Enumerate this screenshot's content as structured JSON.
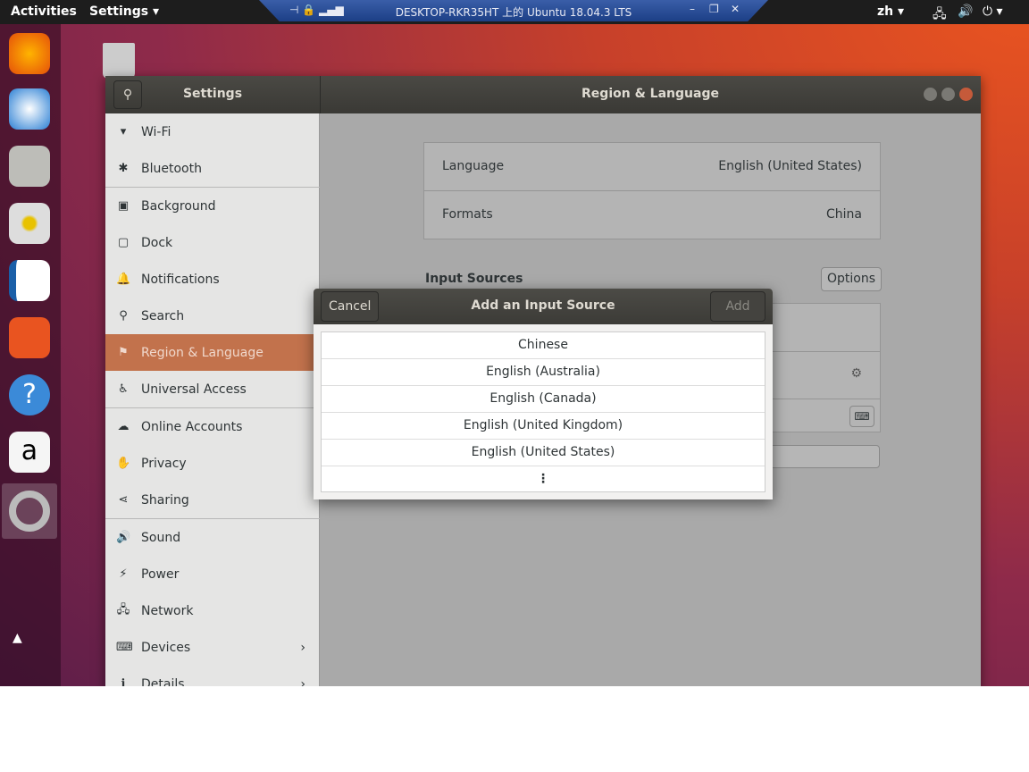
{
  "topbar": {
    "activities": "Activities",
    "app_menu": "Settings ▾",
    "lang": "zh ▾",
    "rdp_title": "DESKTOP-RKR35HT 上的 Ubuntu 18.04.3 LTS"
  },
  "window": {
    "sidebar_title": "Settings",
    "title": "Region & Language"
  },
  "sidebar": {
    "items": [
      {
        "label": "Wi-Fi",
        "icon": "▾"
      },
      {
        "label": "Bluetooth",
        "icon": "✱"
      },
      {
        "label": "Background",
        "icon": "▣"
      },
      {
        "label": "Dock",
        "icon": "▢"
      },
      {
        "label": "Notifications",
        "icon": "🔔"
      },
      {
        "label": "Search",
        "icon": "⚲"
      },
      {
        "label": "Region & Language",
        "icon": "⚑"
      },
      {
        "label": "Universal Access",
        "icon": "♿"
      },
      {
        "label": "Online Accounts",
        "icon": "☁"
      },
      {
        "label": "Privacy",
        "icon": "✋"
      },
      {
        "label": "Sharing",
        "icon": "⋖"
      },
      {
        "label": "Sound",
        "icon": "🔊"
      },
      {
        "label": "Power",
        "icon": "⚡"
      },
      {
        "label": "Network",
        "icon": "🖧"
      },
      {
        "label": "Devices",
        "icon": "⌨"
      },
      {
        "label": "Details",
        "icon": "ℹ"
      }
    ]
  },
  "region": {
    "language_label": "Language",
    "language_value": "English (United States)",
    "formats_label": "Formats",
    "formats_value": "China",
    "input_sources": "Input Sources",
    "options": "Options"
  },
  "dialog": {
    "cancel": "Cancel",
    "title": "Add an Input Source",
    "add": "Add",
    "items": [
      "Chinese",
      "English (Australia)",
      "English (Canada)",
      "English (United Kingdom)",
      "English (United States)"
    ],
    "more": "⋮"
  }
}
